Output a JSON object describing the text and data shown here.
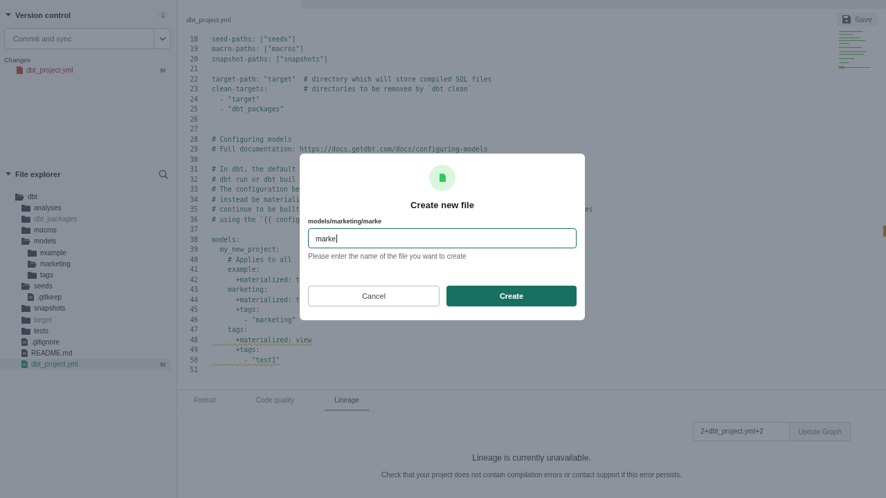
{
  "version_control": {
    "title": "Version control",
    "expanded": true,
    "badge": "1",
    "action": "Commit and sync",
    "changes_label": "Changes",
    "changes": [
      {
        "name": "dbt_project.yml",
        "status": "M"
      }
    ]
  },
  "file_explorer": {
    "title": "File explorer",
    "expanded": true,
    "tree": [
      {
        "name": "dbt",
        "kind": "folder",
        "expanded": true,
        "muted": false,
        "selected": false,
        "children": [
          {
            "name": "analyses",
            "kind": "folder",
            "expanded": false,
            "muted": false,
            "selected": false
          },
          {
            "name": "dbt_packages",
            "kind": "folder",
            "expanded": false,
            "muted": true,
            "selected": false
          },
          {
            "name": "macros",
            "kind": "folder",
            "expanded": false,
            "muted": false,
            "selected": false
          },
          {
            "name": "models",
            "kind": "folder",
            "expanded": true,
            "muted": false,
            "selected": false,
            "children": [
              {
                "name": "example",
                "kind": "folder",
                "expanded": false,
                "muted": false,
                "selected": false
              },
              {
                "name": "marketing",
                "kind": "folder",
                "expanded": true,
                "muted": false,
                "selected": false
              },
              {
                "name": "tags",
                "kind": "folder",
                "expanded": false,
                "muted": false,
                "selected": false
              }
            ]
          },
          {
            "name": "seeds",
            "kind": "folder",
            "expanded": true,
            "muted": false,
            "selected": false,
            "children": [
              {
                "name": ".gitkeep",
                "kind": "file",
                "muted": false,
                "selected": false
              }
            ]
          },
          {
            "name": "snapshots",
            "kind": "folder",
            "expanded": false,
            "muted": false,
            "selected": false
          },
          {
            "name": "target",
            "kind": "folder",
            "expanded": false,
            "muted": true,
            "selected": false
          },
          {
            "name": "tests",
            "kind": "folder",
            "expanded": false,
            "muted": false,
            "selected": false
          },
          {
            "name": ".gitignore",
            "kind": "file",
            "muted": false,
            "selected": false
          },
          {
            "name": "README.md",
            "kind": "file",
            "muted": false,
            "selected": false
          },
          {
            "name": "dbt_project.yml",
            "kind": "file",
            "muted": false,
            "selected": true,
            "status": "M"
          }
        ]
      }
    ]
  },
  "editor": {
    "file_tab": "dbt_project.yml",
    "save": "Save",
    "lines": [
      {
        "num": "18",
        "text": "seed-paths: [\"seeds\"]",
        "warning": false
      },
      {
        "num": "19",
        "text": "macro-paths: [\"macros\"]",
        "warning": false
      },
      {
        "num": "20",
        "text": "snapshot-paths: [\"snapshots\"]",
        "warning": false
      },
      {
        "num": "21"
      },
      {
        "num": "22",
        "text": "target-path: \"target\"  # directory which will store compiled SQL files",
        "warning": false
      },
      {
        "num": "23",
        "text": "clean-targets:         # directories to be removed by `dbt clean`",
        "warning": false
      },
      {
        "num": "24",
        "text": "  - \"target\"",
        "warning": false
      },
      {
        "num": "25",
        "text": "  - \"dbt_packages\"",
        "warning": false
      },
      {
        "num": "26"
      },
      {
        "num": "27"
      },
      {
        "num": "28",
        "text": "# Configuring models",
        "warning": false
      },
      {
        "num": "29",
        "text": "# Full documentation: https://docs.getdbt.com/docs/configuring-models",
        "warning": false
      },
      {
        "num": "30"
      },
      {
        "num": "31",
        "text": "# In dbt, the default",
        "warning": false
      },
      {
        "num": "32",
        "text": "# dbt run or dbt buil",
        "warning": false
      },
      {
        "num": "33",
        "text": "# The configuration be",
        "warning": false
      },
      {
        "num": "34",
        "text": "# instead be materiali",
        "warning": false
      },
      {
        "num": "35",
        "text": "# continue to be built",
        "tail": "es",
        "warning": false
      },
      {
        "num": "36",
        "text": "# using the `{{ config",
        "warning": false
      },
      {
        "num": "37"
      },
      {
        "num": "38",
        "text": "models:",
        "warning": false
      },
      {
        "num": "39",
        "text": "  my_new_project:",
        "warning": false
      },
      {
        "num": "40",
        "text": "    # Applies to all",
        "warning": false
      },
      {
        "num": "41",
        "text": "    example:",
        "warning": false
      },
      {
        "num": "42",
        "text": "      +materialized: t",
        "warning": false
      },
      {
        "num": "43",
        "text": "    marketing:",
        "warning": false
      },
      {
        "num": "44",
        "text": "      +materialized: t",
        "warning": false
      },
      {
        "num": "45",
        "text": "      +tags:",
        "warning": false
      },
      {
        "num": "46",
        "text": "        - \"marketing\"",
        "warning": false
      },
      {
        "num": "47",
        "text": "    tags:",
        "warning": false
      },
      {
        "num": "48",
        "text": "      +materialized: view",
        "warning": true
      },
      {
        "num": "49",
        "text": "      +tags:",
        "warning": false
      },
      {
        "num": "50",
        "text": "        - \"test1\"",
        "warning": true
      },
      {
        "num": "51"
      }
    ]
  },
  "bottom_panel": {
    "tabs": [
      {
        "label": "Format",
        "selected": false
      },
      {
        "label": "Code quality",
        "selected": false
      },
      {
        "label": "Lineage",
        "selected": true
      }
    ],
    "graph_field": "2+dbt_project.yml+2",
    "update_button": "Update Graph",
    "message": "Lineage is currently unavailable.",
    "detail": "Check that your project does not contain compilation errors or contact support if this error persists."
  },
  "dialog": {
    "title": "Create new file",
    "path_label": "models/marketing/marke",
    "value": "marke",
    "hint": "Please enter the name of the file you want to create",
    "cancel": "Cancel",
    "create": "Create"
  }
}
